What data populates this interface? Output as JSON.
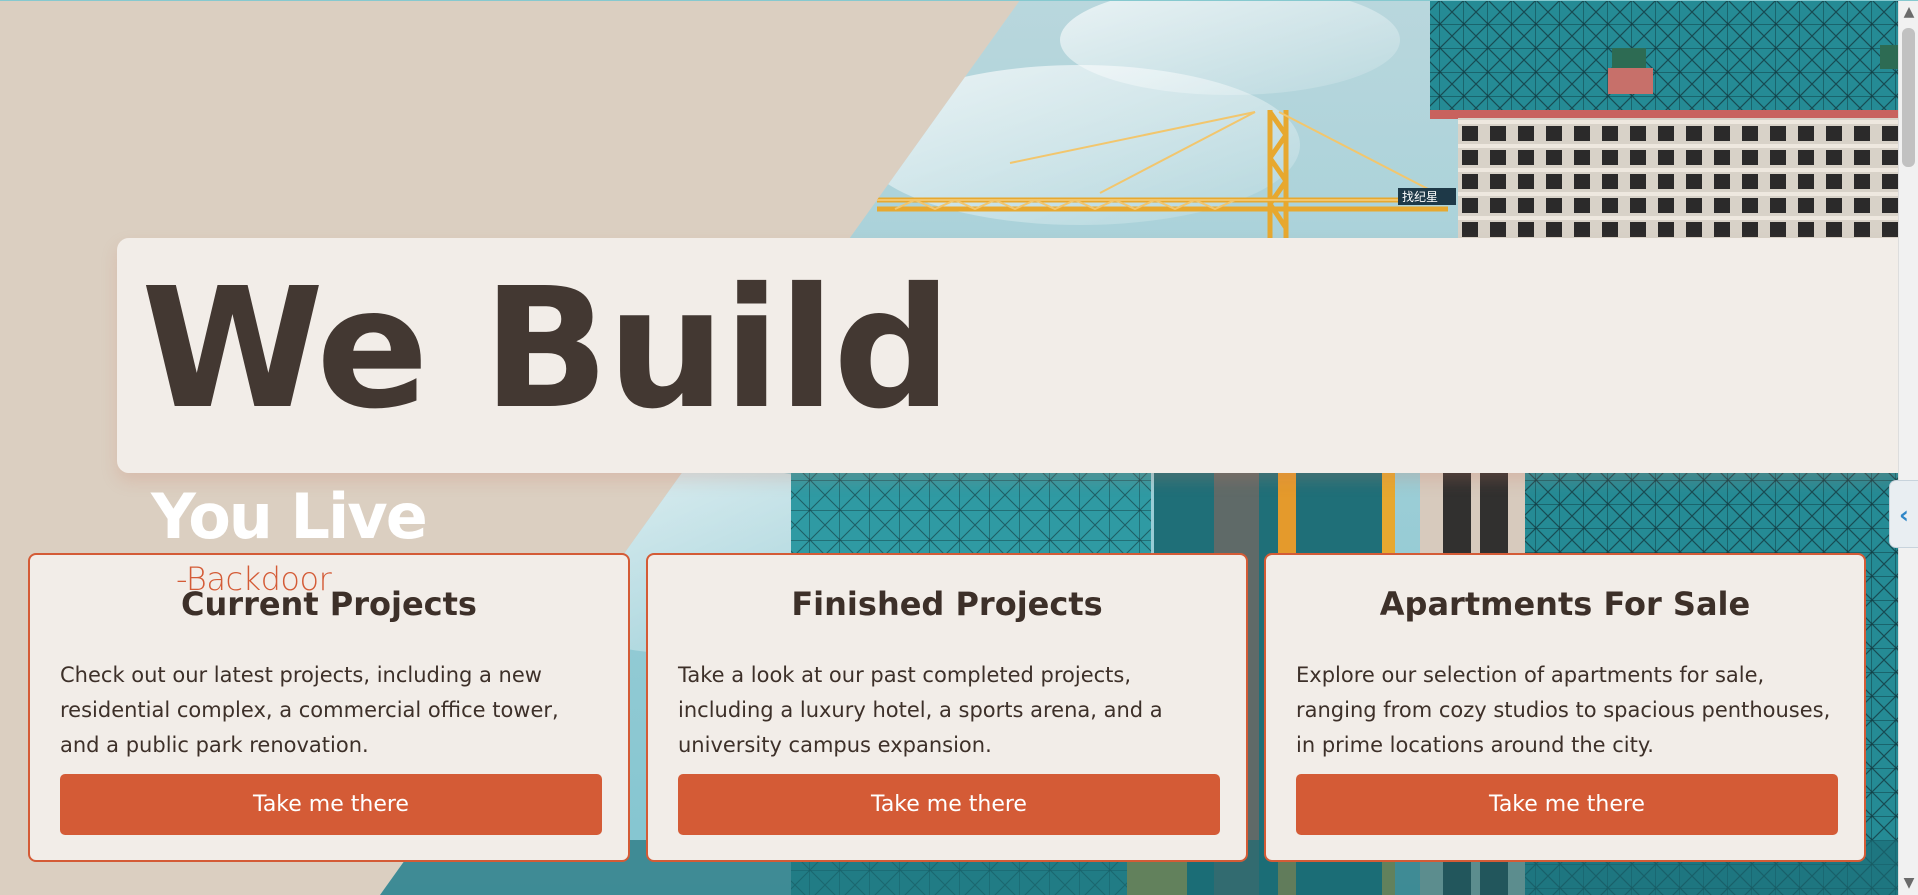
{
  "hero": {
    "headline": "We Build",
    "tagline": "You Live",
    "signature": "-Backdoor",
    "photo_icon": "construction-site-photo",
    "sign_text": "找纪星"
  },
  "cards": [
    {
      "title": "Current Projects",
      "description": "Check out our latest projects, including a new residential complex, a commercial office tower, and a public park renovation.",
      "button_label": "Take me there"
    },
    {
      "title": "Finished Projects",
      "description": "Take a look at our past completed projects, including a luxury hotel, a sports arena, and a university campus expansion.",
      "button_label": "Take me there"
    },
    {
      "title": "Apartments For Sale",
      "description": "Explore our selection of apartments for sale, ranging from cozy studios to spacious penthouses, in prime locations around the city.",
      "button_label": "Take me there"
    }
  ],
  "ui": {
    "side_tab_icon": "chevron-left-icon",
    "side_tab_glyph": "‹",
    "scroll_up_glyph": "▲",
    "scroll_down_glyph": "▼"
  },
  "colors": {
    "background": "#dbcfc1",
    "banner": "#f2ede8",
    "heading_text": "#433832",
    "accent": "#d45b36",
    "tagline": "#ffffff",
    "glass_teal": "#2f939b",
    "crane_yellow": "#e7a82f"
  }
}
